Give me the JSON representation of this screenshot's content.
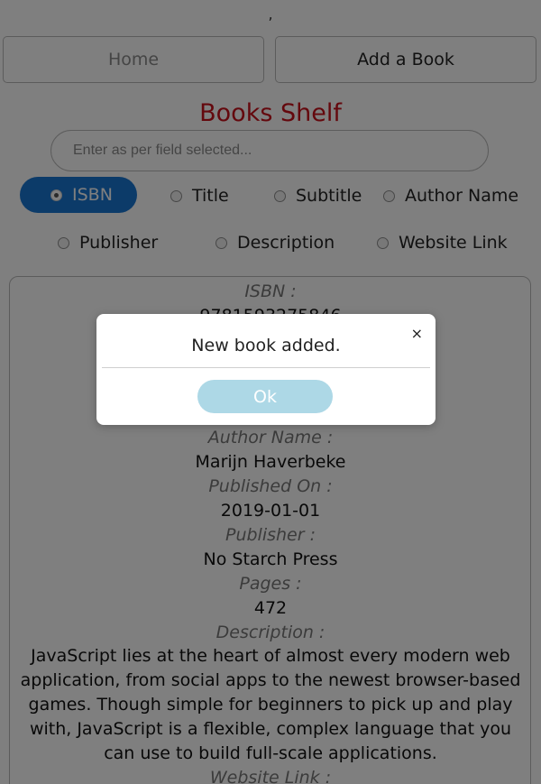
{
  "stray_mark": ",",
  "nav": {
    "home_label": "Home",
    "add_book_label": "Add a Book"
  },
  "page_title": "Books Shelf",
  "search": {
    "placeholder": "Enter as per field selected...",
    "value": ""
  },
  "filters": {
    "selected": "ISBN",
    "options": [
      "ISBN",
      "Title",
      "Subtitle",
      "Author Name",
      "Publisher",
      "Description",
      "Website Link"
    ]
  },
  "book": {
    "isbn_label": "ISBN :",
    "isbn_value": "9781593275846",
    "author_label": "Author Name :",
    "author_value": "Marijn Haverbeke",
    "published_label": "Published On :",
    "published_value": "2019-01-01",
    "publisher_label": "Publisher :",
    "publisher_value": "No Starch Press",
    "pages_label": "Pages :",
    "pages_value": "472",
    "description_label": "Description :",
    "description_value": "JavaScript lies at the heart of almost every modern web application, from social apps to the newest browser-based games. Though simple for beginners to pick up and play with, JavaScript is a flexible, complex language that you can use to build full-scale applications.",
    "website_label": "Website Link :"
  },
  "modal": {
    "message": "New book added.",
    "close_symbol": "×",
    "ok_label": "Ok"
  },
  "colors": {
    "title": "#c8101b",
    "selected_filter": "#1976d2",
    "ok_button": "#add8e6",
    "overlay": "rgba(0,0,0,0.5)"
  }
}
